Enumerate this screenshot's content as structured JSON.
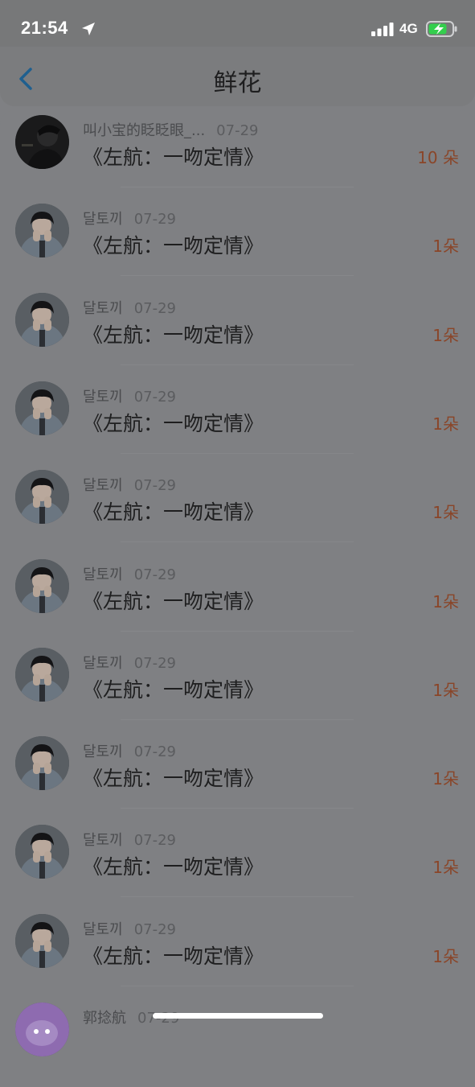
{
  "status_bar": {
    "time": "21:54",
    "network": "4G",
    "icons": [
      "location-arrow-icon",
      "signal-icon",
      "battery-charging-icon"
    ]
  },
  "header": {
    "title": "鲜花",
    "back_icon": "chevron-left-icon"
  },
  "colors": {
    "accent_count": "#8a4528",
    "back_arrow": "#1f5f8f",
    "title": "#1e1e1f"
  },
  "list": [
    {
      "user": "叫小宝的眨眨眼_...",
      "date": "07-29",
      "book": "《左航：一吻定情》",
      "count": "10 朵",
      "avatar": "dark-photo-avatar"
    },
    {
      "user": "달토끼",
      "date": "07-29",
      "book": "《左航：一吻定情》",
      "count": "1朵",
      "avatar": "person-photo-avatar"
    },
    {
      "user": "달토끼",
      "date": "07-29",
      "book": "《左航：一吻定情》",
      "count": "1朵",
      "avatar": "person-photo-avatar"
    },
    {
      "user": "달토끼",
      "date": "07-29",
      "book": "《左航：一吻定情》",
      "count": "1朵",
      "avatar": "person-photo-avatar"
    },
    {
      "user": "달토끼",
      "date": "07-29",
      "book": "《左航：一吻定情》",
      "count": "1朵",
      "avatar": "person-photo-avatar"
    },
    {
      "user": "달토끼",
      "date": "07-29",
      "book": "《左航：一吻定情》",
      "count": "1朵",
      "avatar": "person-photo-avatar"
    },
    {
      "user": "달토끼",
      "date": "07-29",
      "book": "《左航：一吻定情》",
      "count": "1朵",
      "avatar": "person-photo-avatar"
    },
    {
      "user": "달토끼",
      "date": "07-29",
      "book": "《左航：一吻定情》",
      "count": "1朵",
      "avatar": "person-photo-avatar"
    },
    {
      "user": "달토끼",
      "date": "07-29",
      "book": "《左航：一吻定情》",
      "count": "1朵",
      "avatar": "person-photo-avatar"
    },
    {
      "user": "달토끼",
      "date": "07-29",
      "book": "《左航：一吻定情》",
      "count": "1朵",
      "avatar": "person-photo-avatar"
    },
    {
      "user": "郭捻航",
      "date": "07-29",
      "book": "",
      "count": "",
      "avatar": "purple-cartoon-avatar"
    }
  ]
}
